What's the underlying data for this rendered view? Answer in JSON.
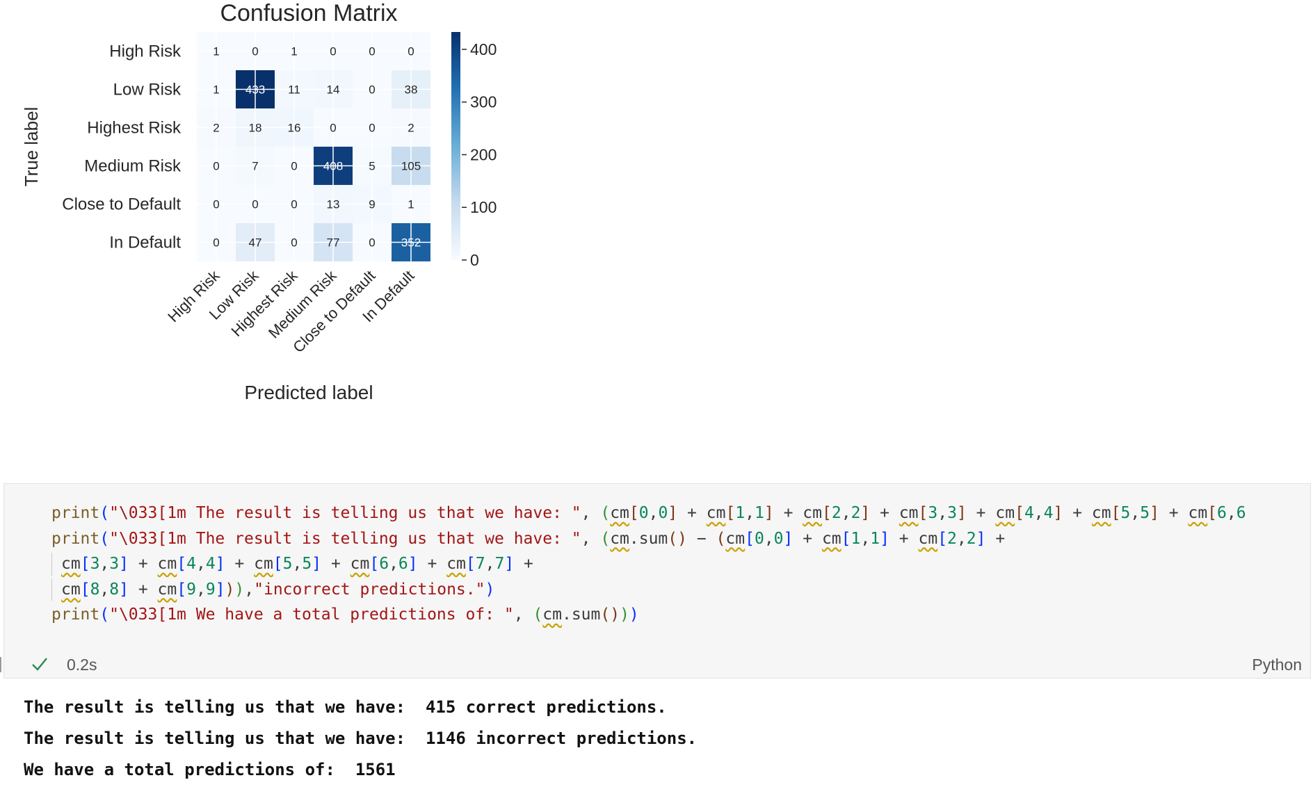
{
  "chart_data": {
    "type": "heatmap",
    "title": "Confusion Matrix",
    "xlabel": "Predicted label",
    "ylabel": "True label",
    "classes": [
      "High Risk",
      "Low Risk",
      "Highest Risk",
      "Medium Risk",
      "Close to Default",
      "In Default"
    ],
    "matrix": [
      [
        1,
        0,
        1,
        0,
        0,
        0
      ],
      [
        1,
        433,
        11,
        14,
        0,
        38
      ],
      [
        2,
        18,
        16,
        0,
        0,
        2
      ],
      [
        0,
        7,
        0,
        408,
        5,
        105
      ],
      [
        0,
        0,
        0,
        13,
        9,
        1
      ],
      [
        0,
        47,
        0,
        77,
        0,
        352
      ]
    ],
    "colorbar": {
      "ticks": [
        0,
        100,
        200,
        300,
        400
      ],
      "range": [
        0,
        433
      ],
      "colormap": "Blues"
    },
    "grid": true
  },
  "code_cell": {
    "lines": [
      [
        {
          "t": "print",
          "c": "fn"
        },
        {
          "t": "(",
          "c": "p1"
        },
        {
          "t": "\"\\033[1m The result is telling us that we have: \"",
          "c": "str"
        },
        {
          "t": ", ",
          "c": ""
        },
        {
          "t": "(",
          "c": "p2"
        },
        {
          "t": "cm",
          "c": "sq"
        },
        {
          "t": "[",
          "c": "p3"
        },
        {
          "t": "0",
          "c": "num"
        },
        {
          "t": ",",
          "c": ""
        },
        {
          "t": "0",
          "c": "num"
        },
        {
          "t": "]",
          "c": "p3"
        },
        {
          "t": " + ",
          "c": ""
        },
        {
          "t": "cm",
          "c": "sq"
        },
        {
          "t": "[",
          "c": "p3"
        },
        {
          "t": "1",
          "c": "num"
        },
        {
          "t": ",",
          "c": ""
        },
        {
          "t": "1",
          "c": "num"
        },
        {
          "t": "]",
          "c": "p3"
        },
        {
          "t": " + ",
          "c": ""
        },
        {
          "t": "cm",
          "c": "sq"
        },
        {
          "t": "[",
          "c": "p3"
        },
        {
          "t": "2",
          "c": "num"
        },
        {
          "t": ",",
          "c": ""
        },
        {
          "t": "2",
          "c": "num"
        },
        {
          "t": "]",
          "c": "p3"
        },
        {
          "t": " + ",
          "c": ""
        },
        {
          "t": "cm",
          "c": "sq"
        },
        {
          "t": "[",
          "c": "p3"
        },
        {
          "t": "3",
          "c": "num"
        },
        {
          "t": ",",
          "c": ""
        },
        {
          "t": "3",
          "c": "num"
        },
        {
          "t": "]",
          "c": "p3"
        },
        {
          "t": " + ",
          "c": ""
        },
        {
          "t": "cm",
          "c": "sq"
        },
        {
          "t": "[",
          "c": "p3"
        },
        {
          "t": "4",
          "c": "num"
        },
        {
          "t": ",",
          "c": ""
        },
        {
          "t": "4",
          "c": "num"
        },
        {
          "t": "]",
          "c": "p3"
        },
        {
          "t": " + ",
          "c": ""
        },
        {
          "t": "cm",
          "c": "sq"
        },
        {
          "t": "[",
          "c": "p3"
        },
        {
          "t": "5",
          "c": "num"
        },
        {
          "t": ",",
          "c": ""
        },
        {
          "t": "5",
          "c": "num"
        },
        {
          "t": "]",
          "c": "p3"
        },
        {
          "t": " + ",
          "c": ""
        },
        {
          "t": "cm",
          "c": "sq"
        },
        {
          "t": "[",
          "c": "p3"
        },
        {
          "t": "6",
          "c": "num"
        },
        {
          "t": ",",
          "c": ""
        },
        {
          "t": "6",
          "c": "num"
        }
      ],
      [
        {
          "t": "print",
          "c": "fn"
        },
        {
          "t": "(",
          "c": "p1"
        },
        {
          "t": "\"\\033[1m The result is telling us that we have: \"",
          "c": "str"
        },
        {
          "t": ", ",
          "c": ""
        },
        {
          "t": "(",
          "c": "p2"
        },
        {
          "t": "cm",
          "c": "sq"
        },
        {
          "t": ".sum",
          "c": ""
        },
        {
          "t": "()",
          "c": "p3"
        },
        {
          "t": " − ",
          "c": ""
        },
        {
          "t": "(",
          "c": "p3"
        },
        {
          "t": "cm",
          "c": "sq"
        },
        {
          "t": "[",
          "c": "p1"
        },
        {
          "t": "0",
          "c": "num"
        },
        {
          "t": ",",
          "c": ""
        },
        {
          "t": "0",
          "c": "num"
        },
        {
          "t": "]",
          "c": "p1"
        },
        {
          "t": " + ",
          "c": ""
        },
        {
          "t": "cm",
          "c": "sq"
        },
        {
          "t": "[",
          "c": "p1"
        },
        {
          "t": "1",
          "c": "num"
        },
        {
          "t": ",",
          "c": ""
        },
        {
          "t": "1",
          "c": "num"
        },
        {
          "t": "]",
          "c": "p1"
        },
        {
          "t": " + ",
          "c": ""
        },
        {
          "t": "cm",
          "c": "sq"
        },
        {
          "t": "[",
          "c": "p1"
        },
        {
          "t": "2",
          "c": "num"
        },
        {
          "t": ",",
          "c": ""
        },
        {
          "t": "2",
          "c": "num"
        },
        {
          "t": "]",
          "c": "p1"
        },
        {
          "t": " +",
          "c": ""
        }
      ],
      [
        {
          "t": "cm",
          "c": "sq"
        },
        {
          "t": "[",
          "c": "p1"
        },
        {
          "t": "3",
          "c": "num"
        },
        {
          "t": ",",
          "c": ""
        },
        {
          "t": "3",
          "c": "num"
        },
        {
          "t": "]",
          "c": "p1"
        },
        {
          "t": " + ",
          "c": ""
        },
        {
          "t": "cm",
          "c": "sq"
        },
        {
          "t": "[",
          "c": "p1"
        },
        {
          "t": "4",
          "c": "num"
        },
        {
          "t": ",",
          "c": ""
        },
        {
          "t": "4",
          "c": "num"
        },
        {
          "t": "]",
          "c": "p1"
        },
        {
          "t": " + ",
          "c": ""
        },
        {
          "t": "cm",
          "c": "sq"
        },
        {
          "t": "[",
          "c": "p1"
        },
        {
          "t": "5",
          "c": "num"
        },
        {
          "t": ",",
          "c": ""
        },
        {
          "t": "5",
          "c": "num"
        },
        {
          "t": "]",
          "c": "p1"
        },
        {
          "t": " + ",
          "c": ""
        },
        {
          "t": "cm",
          "c": "sq"
        },
        {
          "t": "[",
          "c": "p1"
        },
        {
          "t": "6",
          "c": "num"
        },
        {
          "t": ",",
          "c": ""
        },
        {
          "t": "6",
          "c": "num"
        },
        {
          "t": "]",
          "c": "p1"
        },
        {
          "t": " + ",
          "c": ""
        },
        {
          "t": "cm",
          "c": "sq"
        },
        {
          "t": "[",
          "c": "p1"
        },
        {
          "t": "7",
          "c": "num"
        },
        {
          "t": ",",
          "c": ""
        },
        {
          "t": "7",
          "c": "num"
        },
        {
          "t": "]",
          "c": "p1"
        },
        {
          "t": " +",
          "c": ""
        }
      ],
      [
        {
          "t": "cm",
          "c": "sq"
        },
        {
          "t": "[",
          "c": "p1"
        },
        {
          "t": "8",
          "c": "num"
        },
        {
          "t": ",",
          "c": ""
        },
        {
          "t": "8",
          "c": "num"
        },
        {
          "t": "]",
          "c": "p1"
        },
        {
          "t": " + ",
          "c": ""
        },
        {
          "t": "cm",
          "c": "sq"
        },
        {
          "t": "[",
          "c": "p1"
        },
        {
          "t": "9",
          "c": "num"
        },
        {
          "t": ",",
          "c": ""
        },
        {
          "t": "9",
          "c": "num"
        },
        {
          "t": "]",
          "c": "p1"
        },
        {
          "t": ")",
          "c": "p3"
        },
        {
          "t": ")",
          "c": "p2"
        },
        {
          "t": ",",
          "c": ""
        },
        {
          "t": "\"incorrect predictions.\"",
          "c": "str"
        },
        {
          "t": ")",
          "c": "p1"
        }
      ],
      [
        {
          "t": "print",
          "c": "fn"
        },
        {
          "t": "(",
          "c": "p1"
        },
        {
          "t": "\"\\033[1m We have a total predictions of: \"",
          "c": "str"
        },
        {
          "t": ", ",
          "c": ""
        },
        {
          "t": "(",
          "c": "p2"
        },
        {
          "t": "cm",
          "c": "sq"
        },
        {
          "t": ".sum",
          "c": ""
        },
        {
          "t": "()",
          "c": "p3"
        },
        {
          "t": ")",
          "c": "p2"
        },
        {
          "t": ")",
          "c": "p1"
        }
      ]
    ],
    "continuation_lines": [
      2,
      3
    ],
    "duration": "0.2s",
    "language": "Python"
  },
  "output": {
    "lines": [
      "The result is telling us that we have:  415 correct predictions.",
      "The result is telling us that we have:  1146 incorrect predictions.",
      "We have a total predictions of:  1561"
    ]
  },
  "colors": {
    "check": "#2e8b57",
    "cell_bg": "#f6f6f6",
    "heatmap_dark": "#08306b",
    "heatmap_light": "#f7fbff"
  }
}
